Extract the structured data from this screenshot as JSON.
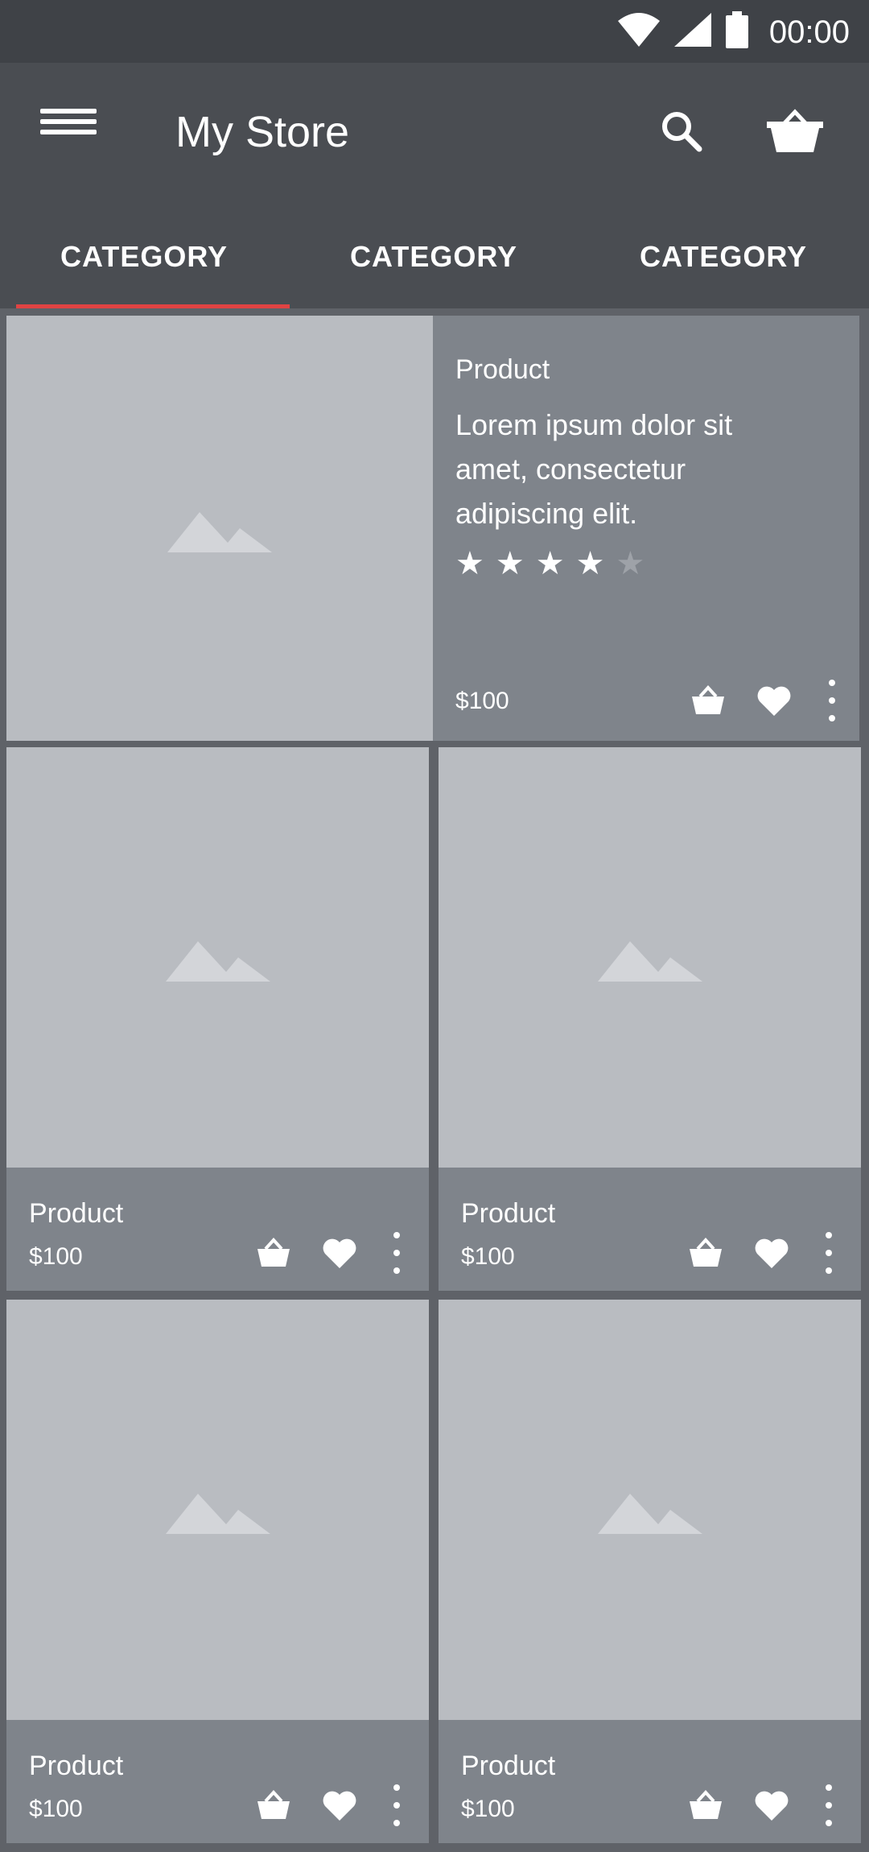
{
  "status_bar": {
    "time": "00:00"
  },
  "toolbar": {
    "title": "My Store"
  },
  "tabs": [
    {
      "label": "CATEGORY"
    },
    {
      "label": "CATEGORY"
    },
    {
      "label": "CATEGORY"
    }
  ],
  "featured": {
    "name": "Product",
    "description": "Lorem ipsum dolor sit amet, consectetur adipiscing elit.",
    "rating": 4,
    "rating_max": 5,
    "price": "$100"
  },
  "products": [
    {
      "name": "Product",
      "price": "$100"
    },
    {
      "name": "Product",
      "price": "$100"
    },
    {
      "name": "Product",
      "price": "$100"
    },
    {
      "name": "Product",
      "price": "$100"
    }
  ],
  "icons": {
    "menu": "menu-icon",
    "search": "search-icon",
    "cart": "shopping-basket-icon",
    "add": "basket-icon",
    "favorite": "heart-icon",
    "more": "more-vert-icon"
  }
}
